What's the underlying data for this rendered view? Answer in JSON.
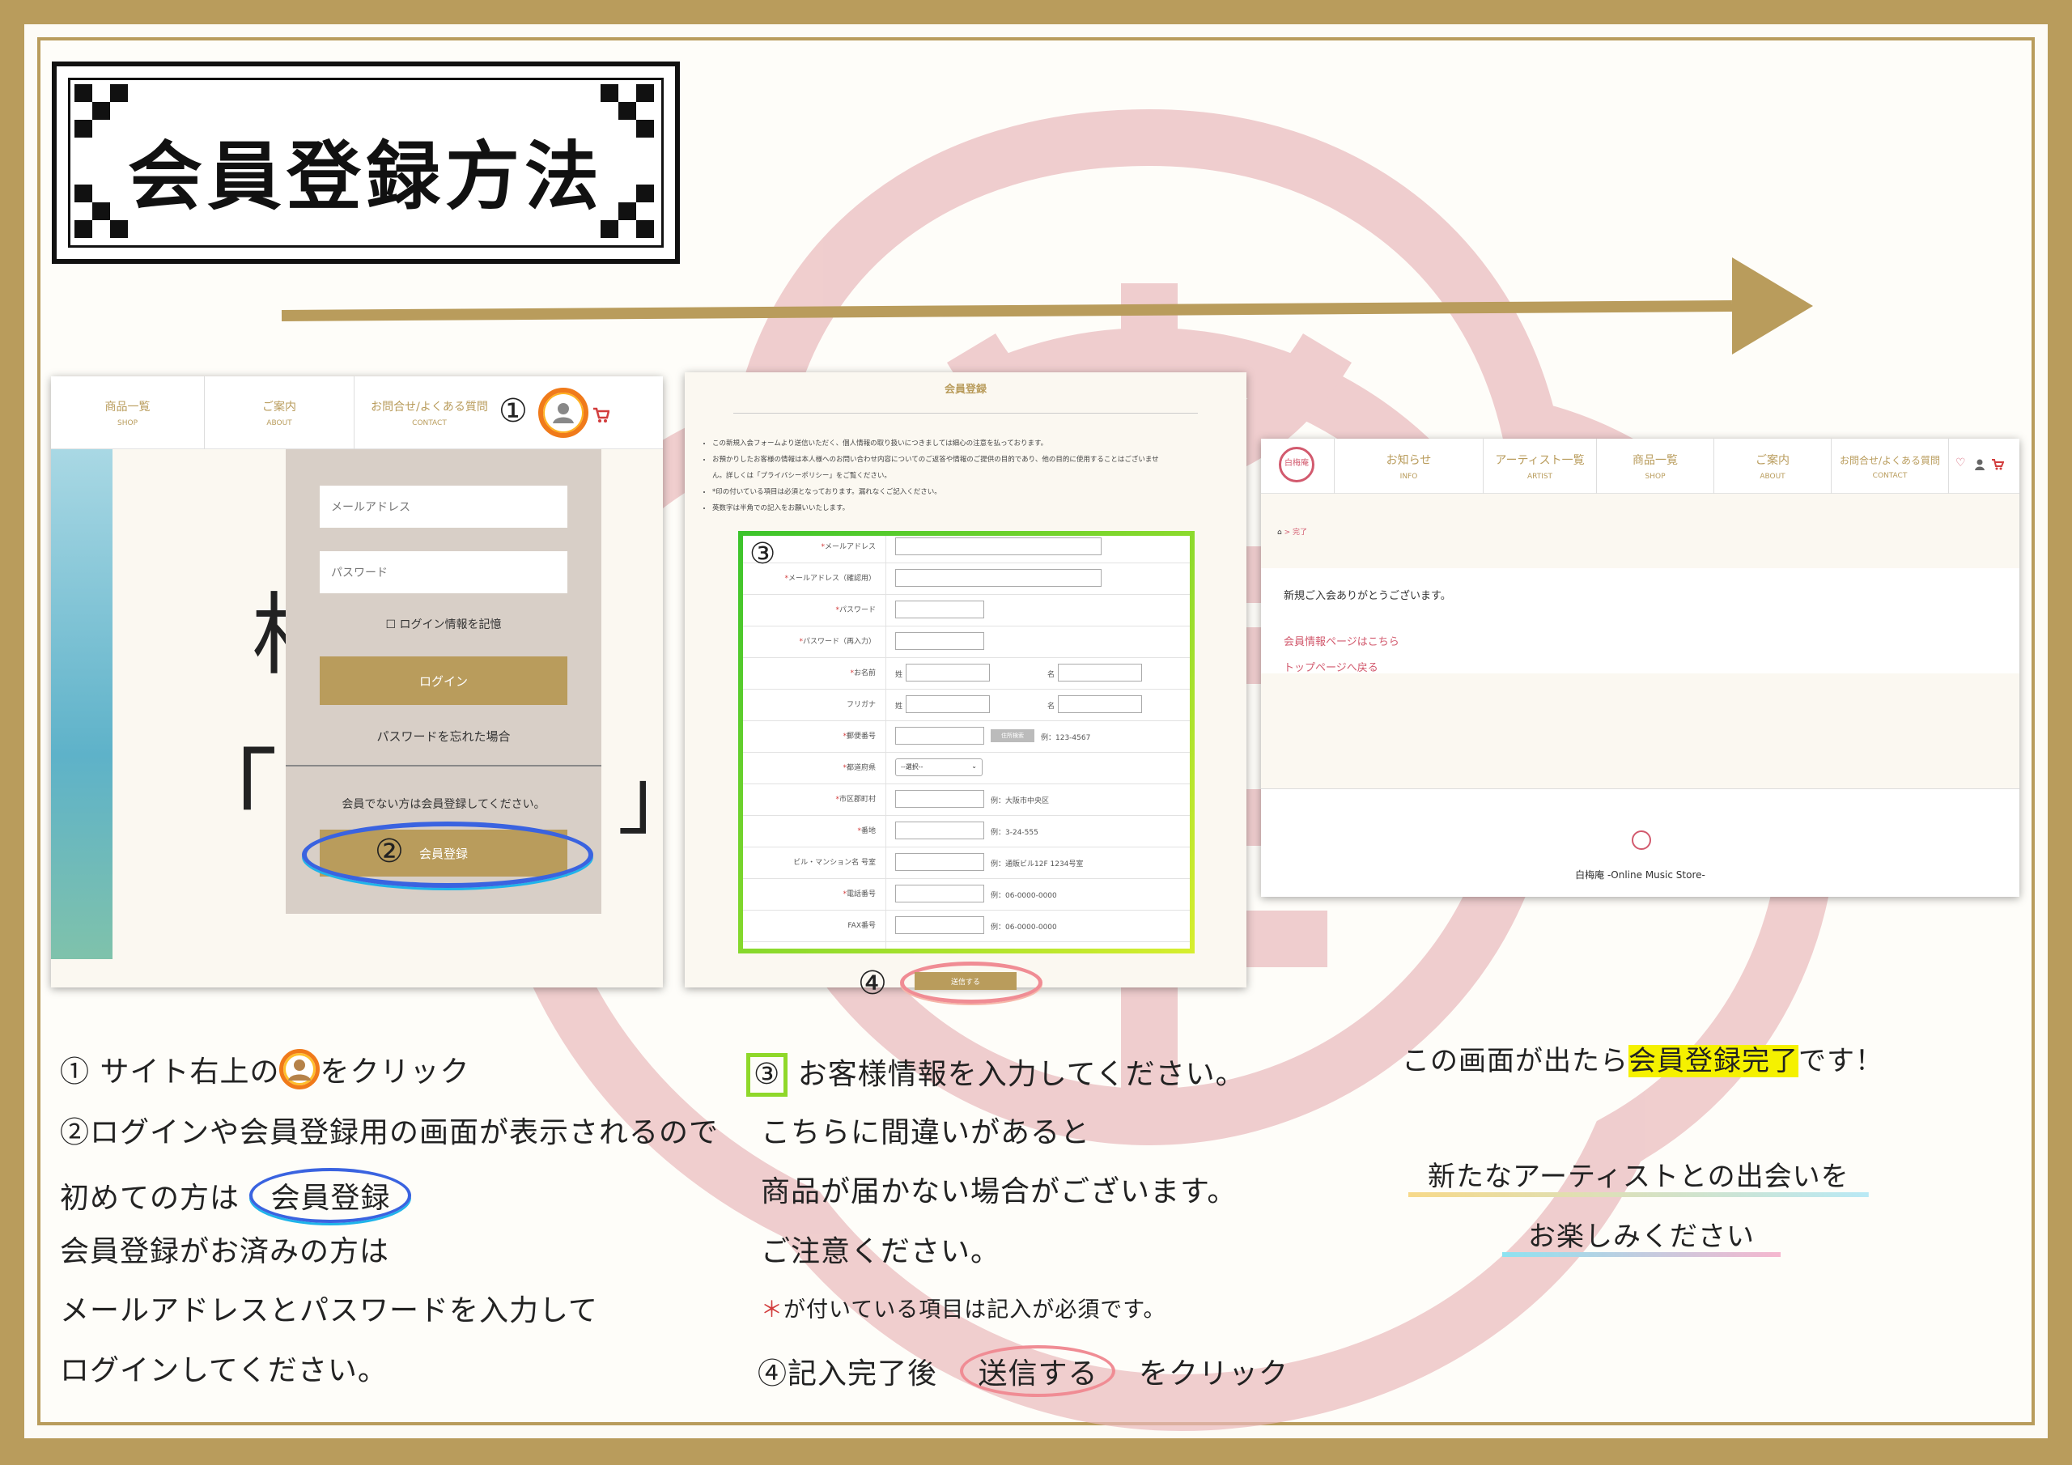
{
  "title": "会員登録方法",
  "colors": {
    "gold": "#b99c5c",
    "watermark": "#e7b0b4",
    "pink": "#d25a6e",
    "blue": "#2d6ad6",
    "green_yellow": "#c8e623"
  },
  "step1": {
    "nav": [
      {
        "label": "商品一覧",
        "sub": "SHOP"
      },
      {
        "label": "ご案内",
        "sub": "ABOUT"
      },
      {
        "label": "お問合せ/よくある質問",
        "sub": "CONTACT"
      }
    ],
    "marker": "①",
    "email_placeholder": "メールアドレス",
    "password_placeholder": "パスワード",
    "remember_label": "ログイン情報を記憶",
    "login_button": "ログイン",
    "forgot_link": "パスワードを忘れた場合",
    "non_member_text": "会員でない方は会員登録してください。",
    "marker2": "②",
    "register_button": "会員登録",
    "bg_text1": "相",
    "bg_text2": "「 J",
    "bg_text3": "」"
  },
  "step2": {
    "heading": "会員登録",
    "notes": [
      "この新規入会フォームより送信いただく、個人情報の取り扱いにつきましては細心の注意を払っております。",
      "お預かりしたお客様の情報は本人様へのお問い合わせ内容についてのご返答や情報のご提供の目的であり、他の目的に使用することはございませ",
      "ん。詳しくは「プライバシーポリシー」をご覧ください。",
      "*印の付いている項目は必須となっております。漏れなくご記入ください。",
      "英数字は半角での記入をお願いいたします。"
    ],
    "marker": "③",
    "rows": [
      {
        "label": "メールアドレス",
        "req": true,
        "example": ""
      },
      {
        "label": "メールアドレス（確認用）",
        "req": true,
        "example": ""
      },
      {
        "label": "パスワード",
        "req": true,
        "example": ""
      },
      {
        "label": "パスワード（再入力）",
        "req": true,
        "example": ""
      },
      {
        "label": "お名前",
        "req": true,
        "example": ""
      },
      {
        "label": "フリガナ",
        "req": false,
        "example": ""
      },
      {
        "label": "郵便番号",
        "req": true,
        "example": "例：123-4567"
      },
      {
        "label": "都道府県",
        "req": true,
        "example": ""
      },
      {
        "label": "市区郡町村",
        "req": true,
        "example": "例：大阪市中央区"
      },
      {
        "label": "番地",
        "req": true,
        "example": "例：3-24-555"
      },
      {
        "label": "ビル・マンション名 号室",
        "req": false,
        "example": "例：通販ビル12F 1234号室"
      },
      {
        "label": "電話番号",
        "req": true,
        "example": "例：06-0000-0000"
      },
      {
        "label": "FAX番号",
        "req": false,
        "example": "例：06-0000-0000"
      }
    ],
    "sei": "姓",
    "mei": "名",
    "zip_button": "住所検索",
    "pref_select": "--選択--",
    "marker4": "④",
    "submit_button": "送信する"
  },
  "step3": {
    "nav": [
      {
        "label": "お知らせ",
        "sub": "INFO"
      },
      {
        "label": "アーティスト一覧",
        "sub": "ARTIST"
      },
      {
        "label": "商品一覧",
        "sub": "SHOP"
      },
      {
        "label": "ご案内",
        "sub": "ABOUT"
      },
      {
        "label": "お問合せ/よくある質問",
        "sub": "CONTACT"
      }
    ],
    "logo_text": "白梅庵",
    "breadcrumb": "完了",
    "thanks": "新規ご入会ありがとうございます。",
    "link1": "会員情報ページはこちら",
    "link2": "トップページへ戻る",
    "footer": "白梅庵 -Online Music Store-"
  },
  "captions": {
    "left": {
      "l1_a": "①",
      "l1_b": "サイト右上の",
      "l1_c": "をクリック",
      "l2": "②ログインや会員登録用の画面が表示されるので",
      "l3_a": "初めての方は",
      "l3_b": "会員登録",
      "l4": "会員登録がお済みの方は",
      "l5": "メールアドレスとパスワードを入力して",
      "l6": "ログインしてください。"
    },
    "middle": {
      "l1_a": "③",
      "l1_b": "お客様情報を入力してください。",
      "l2": "こちらに間違いがあると",
      "l3": "商品が届かない場合がございます。",
      "l4": "ご注意ください。",
      "l5_a": "＊",
      "l5_b": "が付いている項目は記入が必須です。",
      "l6_a": "④記入完了後",
      "l6_b": "送信する",
      "l6_c": "をクリック"
    },
    "right": {
      "l1_a": "この画面が出たら",
      "l1_b": "会員登録完了",
      "l1_c": "です！",
      "l2": "新たなアーティストとの出会いを",
      "l3": "お楽しみください"
    }
  }
}
